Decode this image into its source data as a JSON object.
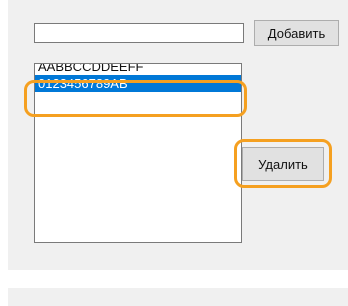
{
  "form": {
    "input_value": "",
    "add_label": "Добавить",
    "delete_label": "Удалить",
    "list_items": [
      "AABBCCDDEEFF",
      "0123456789AB"
    ]
  },
  "colors": {
    "highlight": "#f5a020",
    "selection": "#0078d7",
    "panel_background": "#f0f0f0"
  }
}
